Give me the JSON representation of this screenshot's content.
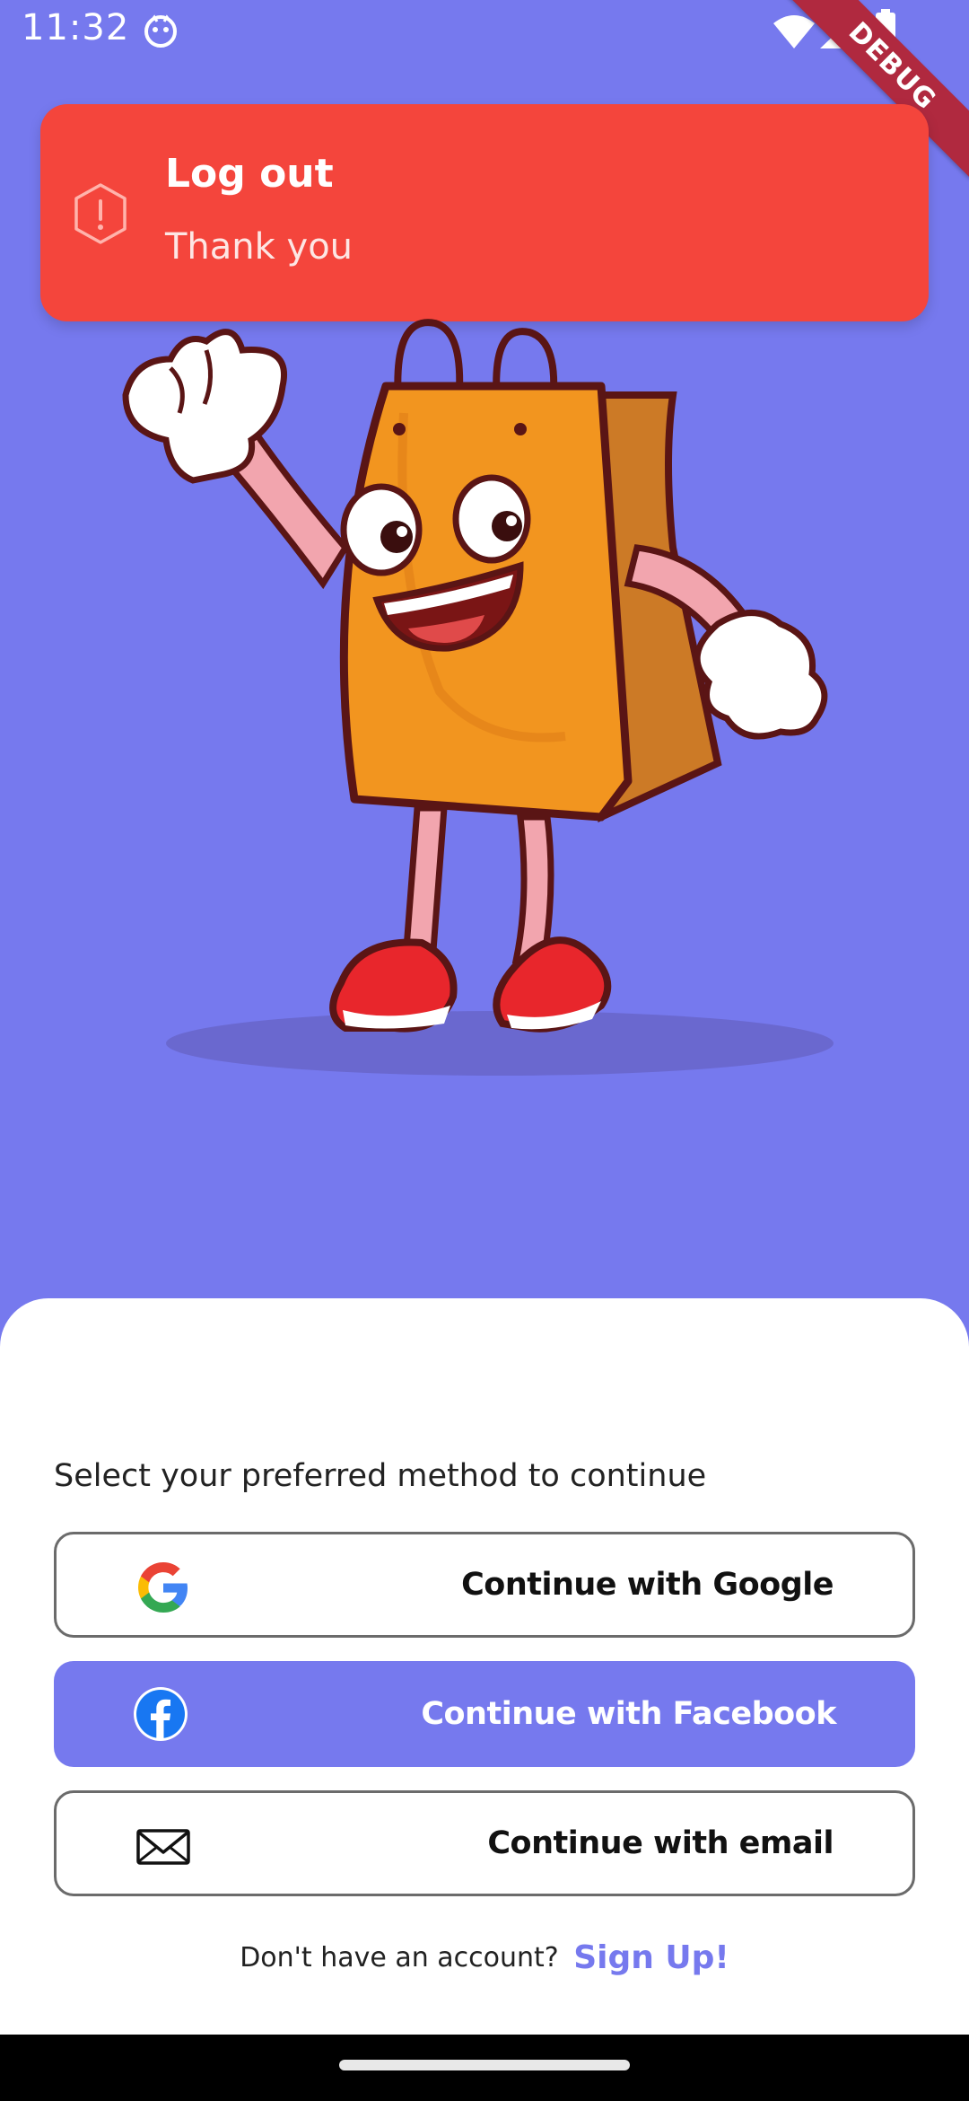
{
  "status_bar": {
    "time": "11:32",
    "icons": [
      "app-notification-icon",
      "wifi-icon",
      "signal-icon",
      "battery-icon"
    ]
  },
  "debug_banner": "DEBUG",
  "toast": {
    "title": "Log out",
    "message": "Thank you",
    "icon": "alert-hexagon-icon",
    "color": "#f4453c"
  },
  "hero": {
    "image": "shopping-bag-mascot-illustration",
    "background": "#7679ee"
  },
  "sheet": {
    "prompt": "Select your preferred method to continue",
    "buttons": [
      {
        "label": "Continue with Google",
        "icon": "google-icon"
      },
      {
        "label": "Continue with Facebook",
        "icon": "facebook-icon"
      },
      {
        "label": "Continue with email",
        "icon": "mail-icon"
      }
    ],
    "signup_prompt": "Don't have an account?",
    "signup_link": "Sign Up!"
  },
  "colors": {
    "accent": "#7679ee",
    "toast": "#f4453c",
    "button_border": "#6b6b6b"
  }
}
